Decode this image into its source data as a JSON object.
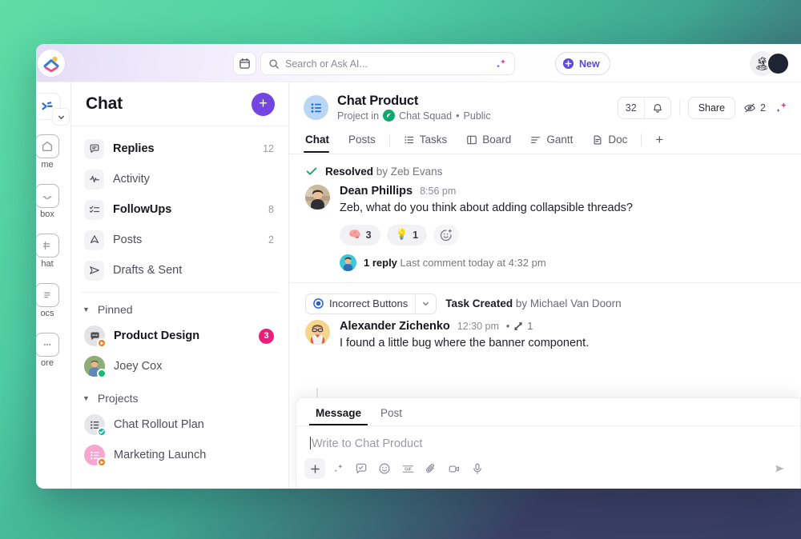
{
  "topbar": {
    "calendar_icon": "calendar-icon",
    "search_placeholder": "Search or Ask AI...",
    "search_value": "",
    "search_icon": "search-icon",
    "ai_sparkle_icon": "ai-sparkle-icon",
    "new_label": "New",
    "new_icon": "plus-circle-icon",
    "avatar_emoji": "🏝",
    "logo_icon": "clickup-logo-icon"
  },
  "rail": {
    "collapse_icon": "chevron-down-icon",
    "items": [
      {
        "label": "me",
        "icon": "home-icon"
      },
      {
        "label": "box",
        "icon": "inbox-icon"
      },
      {
        "label": "hat",
        "icon": "chat-icon"
      },
      {
        "label": "ocs",
        "icon": "docs-icon"
      },
      {
        "label": "ore",
        "icon": "more-icon"
      }
    ]
  },
  "chat_panel": {
    "title": "Chat",
    "add_button_icon": "plus-icon",
    "items": [
      {
        "label": "Replies",
        "count": "12",
        "icon": "reply-bubble-icon",
        "bold": true
      },
      {
        "label": "Activity",
        "count": "",
        "icon": "activity-pulse-icon",
        "bold": false
      },
      {
        "label": "FollowUps",
        "count": "8",
        "icon": "checklist-icon",
        "bold": true
      },
      {
        "label": "Posts",
        "count": "2",
        "icon": "megaphone-icon",
        "bold": false
      },
      {
        "label": "Drafts & Sent",
        "count": "",
        "icon": "send-plane-icon",
        "bold": false
      }
    ],
    "groups": [
      {
        "name": "Pinned",
        "caret_icon": "caret-down-icon",
        "rows": [
          {
            "label": "Product Design",
            "badge": "3",
            "avatar": "chat-group-avatar",
            "bold": true,
            "status": "orange-flag"
          },
          {
            "label": "Joey Cox",
            "badge": "",
            "avatar": "person-avatar",
            "bold": false,
            "status": "online-green"
          }
        ]
      },
      {
        "name": "Projects",
        "caret_icon": "caret-down-icon",
        "rows": [
          {
            "label": "Chat Rollout Plan",
            "badge": "",
            "avatar": "list-avatar-gray",
            "bold": false,
            "status": "teal-check"
          },
          {
            "label": "Marketing Launch",
            "badge": "",
            "avatar": "list-avatar-pink",
            "bold": false,
            "status": "orange-flag"
          }
        ]
      }
    ]
  },
  "main_header": {
    "project_icon": "project-list-icon",
    "project_name": "Chat Product",
    "sub_prefix": "Project in",
    "space_name": "Chat Squad",
    "space_icon": "space-leaf-icon",
    "sub_sep": "•",
    "visibility": "Public",
    "notify_count": "32",
    "bell_icon": "bell-icon",
    "share_label": "Share",
    "eye_icon": "eye-slash-icon",
    "eye_count": "2",
    "ai_icon": "ai-sparkle-icon",
    "tabs": [
      {
        "label": "Chat",
        "icon": "",
        "active": true
      },
      {
        "label": "Posts",
        "icon": "",
        "active": false
      },
      {
        "label": "Tasks",
        "icon": "list-icon",
        "active": false
      },
      {
        "label": "Board",
        "icon": "board-icon",
        "active": false
      },
      {
        "label": "Gantt",
        "icon": "gantt-icon",
        "active": false
      },
      {
        "label": "Doc",
        "icon": "doc-icon",
        "active": false
      }
    ],
    "add_tab_icon": "plus-icon"
  },
  "stream": {
    "resolved": {
      "icon": "check-icon",
      "label": "Resolved",
      "by": "by Zeb Evans"
    },
    "messages": [
      {
        "author": "Dean Phillips",
        "time": "8:56 pm",
        "meta": "",
        "text": "Zeb, what do you think about adding collapsible threads?",
        "avatar": "dean-avatar",
        "reactions": [
          {
            "emoji": "🧠",
            "count": "3"
          },
          {
            "emoji": "💡",
            "count": "1"
          }
        ],
        "add_reaction_icon": "add-reaction-icon",
        "thread": {
          "avatar": "replier-avatar",
          "count_label": "1 reply",
          "last_comment": "Last comment today at 4:32 pm"
        }
      }
    ],
    "task_event": {
      "chip_label": "Incorrect Buttons",
      "chip_status_icon": "task-status-radio-icon",
      "chip_caret_icon": "chevron-down-icon",
      "note_prefix": "Task Created",
      "note_by": "by Michael Van Doorn"
    },
    "message2": {
      "author": "Alexander Zichenko",
      "time": "12:30 pm",
      "sep": "•",
      "thread_icon": "thread-arrows-icon",
      "thread_count": "1",
      "text": "I found a little bug where the banner component.",
      "avatar": "alexander-avatar"
    }
  },
  "composer": {
    "tabs": [
      {
        "label": "Message",
        "active": true
      },
      {
        "label": "Post",
        "active": false
      }
    ],
    "placeholder": "Write to Chat Product",
    "value": "",
    "tools": [
      {
        "name": "add-icon",
        "glyph": "+"
      },
      {
        "name": "ai-sparkle-icon",
        "glyph": ""
      },
      {
        "name": "task-check-icon",
        "glyph": ""
      },
      {
        "name": "emoji-icon",
        "glyph": ""
      },
      {
        "name": "gif-icon",
        "glyph": ""
      },
      {
        "name": "attachment-icon",
        "glyph": ""
      },
      {
        "name": "video-icon",
        "glyph": ""
      },
      {
        "name": "microphone-icon",
        "glyph": ""
      }
    ],
    "send_icon": "send-icon"
  },
  "colors": {
    "accent_purple": "#7445e0",
    "badge_pink": "#ec1e79",
    "space_green": "#0caa6e",
    "resolved_green": "#1aa05e",
    "bg_green": "#5fdda6",
    "bg_navy": "#393e63"
  }
}
